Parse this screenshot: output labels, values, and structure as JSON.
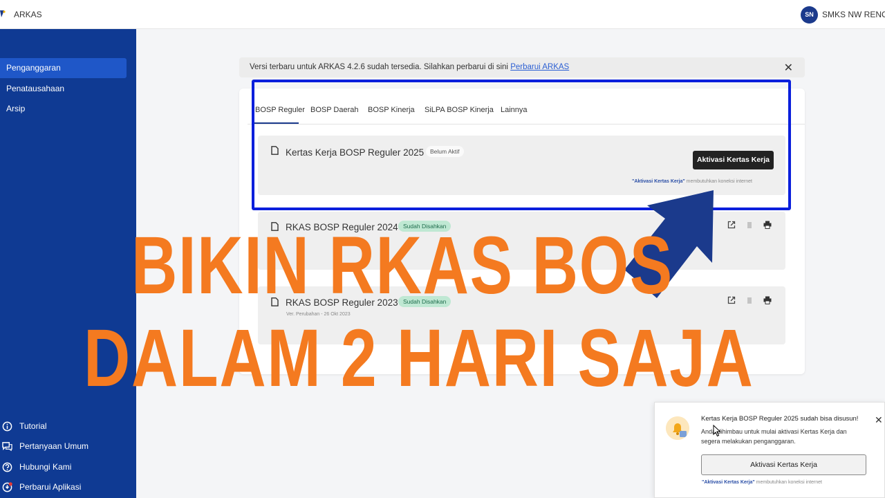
{
  "app": {
    "title": "ARKAS",
    "user_initials": "SN",
    "school": "SMKS NW RENCO"
  },
  "sidebar": {
    "items": [
      {
        "label": "Penganggaran",
        "active": true
      },
      {
        "label": "Penatausahaan"
      },
      {
        "label": "Arsip"
      }
    ],
    "bottom": [
      {
        "label": "Tutorial",
        "icon": "info-icon"
      },
      {
        "label": "Pertanyaan Umum",
        "icon": "chat-icon"
      },
      {
        "label": "Hubungi Kami",
        "icon": "help-icon"
      },
      {
        "label": "Perbarui Aplikasi",
        "icon": "update-icon"
      }
    ]
  },
  "banner": {
    "text": "Versi terbaru untuk ARKAS 4.2.6 sudah tersedia. Silahkan perbarui di sini",
    "link": "Perbarui ARKAS",
    "close": "✕"
  },
  "tabs": [
    "BOSP Reguler",
    "BOSP Daerah",
    "BOSP Kinerja",
    "SiLPA BOSP Kinerja",
    "Lainnya"
  ],
  "documents": [
    {
      "title": "Kertas Kerja BOSP Reguler 2025",
      "badge": "Belum Aktif",
      "button": "Aktivasi Kertas Kerja",
      "note_bold": "\"Aktivasi Kertas Kerja\"",
      "note": "membutuhkan koneksi internet"
    },
    {
      "title": "RKAS BOSP Reguler 2024",
      "badge": "Sudah Disahkan"
    },
    {
      "title": "RKAS BOSP Reguler 2023",
      "badge": "Sudah Disahkan",
      "meta": "Ver. Perubahan - 26 Okt 2023"
    }
  ],
  "overlay": {
    "line1": "BIKIN RKAS BOS",
    "line2": "DALAM 2 HARI SAJA"
  },
  "notification": {
    "title": "Kertas Kerja BOSP Reguler 2025 sudah bisa disusun!",
    "body": "Anda dihimbau untuk mulai aktivasi Kertas Kerja dan segera melakukan penganggaran.",
    "button": "Aktivasi Kertas Kerja",
    "note_bold": "\"Aktivasi Kertas Kerja\"",
    "note": "membutuhkan koneksi internet",
    "close": "✕"
  },
  "colors": {
    "sidebar": "#0f3a93",
    "highlight": "#0a1fdc",
    "arrow": "#1b3a8c",
    "overlay_text": "#f47a20"
  }
}
